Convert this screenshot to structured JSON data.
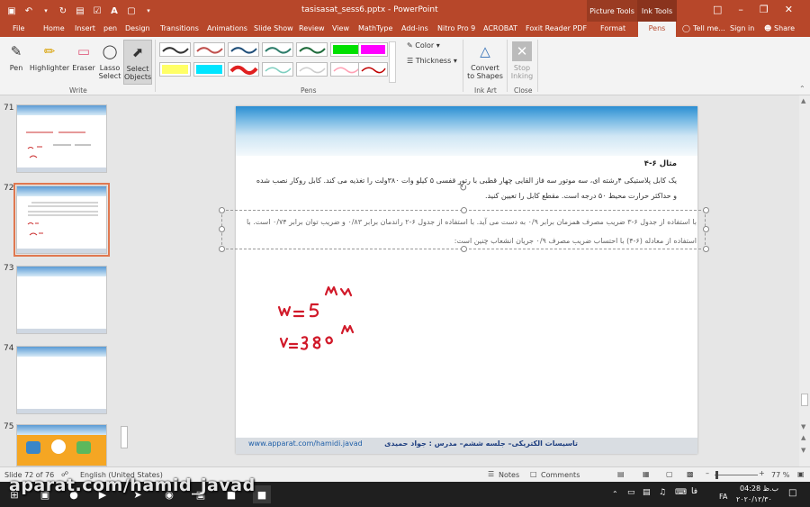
{
  "window": {
    "title": "tasisasat_sess6.pptx - PowerPoint",
    "context_picture_tools": "Picture Tools",
    "context_ink_tools": "Ink Tools"
  },
  "tabs": [
    {
      "label": "File"
    },
    {
      "label": "Home"
    },
    {
      "label": "Insert"
    },
    {
      "label": "pen"
    },
    {
      "label": "Design"
    },
    {
      "label": "Transitions"
    },
    {
      "label": "Animations"
    },
    {
      "label": "Slide Show"
    },
    {
      "label": "Review"
    },
    {
      "label": "View"
    },
    {
      "label": "MathType"
    },
    {
      "label": "Add-ins"
    },
    {
      "label": "Nitro Pro 9"
    },
    {
      "label": "ACROBAT"
    },
    {
      "label": "Foxit Reader PDF"
    },
    {
      "label": "Format"
    }
  ],
  "active_tab": "Pens",
  "tell_me": "Tell me...",
  "sign_in": "Sign in",
  "share": "Share",
  "ribbon": {
    "write": {
      "label": "Write",
      "pen": "Pen",
      "highlighter": "Highlighter",
      "eraser": "Eraser",
      "lasso": "Lasso Select",
      "select_objects": "Select Objects"
    },
    "pens_label": "Pens",
    "color": "Color",
    "thickness": "Thickness",
    "ink_art": {
      "label": "Ink Art",
      "convert": "Convert to Shapes"
    },
    "close": {
      "label": "Close",
      "stop": "Stop Inking"
    },
    "pen_colors": [
      "#333333",
      "#c0504d",
      "#1f4e79",
      "#2e7d6b",
      "#1e6b3a",
      "#00e000",
      "#ff00ff",
      "#ffff66",
      "#00e5ff",
      "#e02020",
      "#7fcfc0",
      "#cccccc",
      "#ffa0b4",
      "#c00000"
    ]
  },
  "slides": [
    {
      "num": "71"
    },
    {
      "num": "72"
    },
    {
      "num": "73"
    },
    {
      "num": "74"
    },
    {
      "num": "75"
    }
  ],
  "slide": {
    "example_title": "مثال ۶-۴",
    "example_text": "یک کابل پلاستیکی ۴رشته ای، سه موتور سه فاز القایی چهار قطبی با رتور قفسی ۵ کیلو وات ۳۸۰ولت را تغذیه می کند. کابل روکار نصب شده و حداکثر حرارت محیط ۵۰ درجه است. مقطع کابل را تعیین کنید.",
    "answer_text": "با استفاده از جدول ۶-۳ ضریب مصرف همزمان برابر ۰/۹ به دست می آید. با استفاده از جدول ۶-۲ راندمان برابر ۰/۸۳ و ضریب توان برابر ۰/۷۴ است. با استفاده از معادله (۶-۴) با احتساب ضریب مصرف ۰/۹ جریان انشعاب چنین است:",
    "footer_url": "www.apparat.com/hamidi.javad",
    "footer_text": "تاسیسات الکتریکی– جلسه ششم– مدرس : جواد حمیدی"
  },
  "status": {
    "slide": "Slide 72 of 76",
    "language": "English (United States)",
    "notes": "Notes",
    "comments": "Comments",
    "zoom": "77 %"
  },
  "taskbar": {
    "time": "04:28 ب.ظ",
    "date": "۲۰۲۰/۱۲/۳۰",
    "lang": "FA",
    "ime": "فا"
  },
  "watermark": "aparat.com/hamid_javad"
}
